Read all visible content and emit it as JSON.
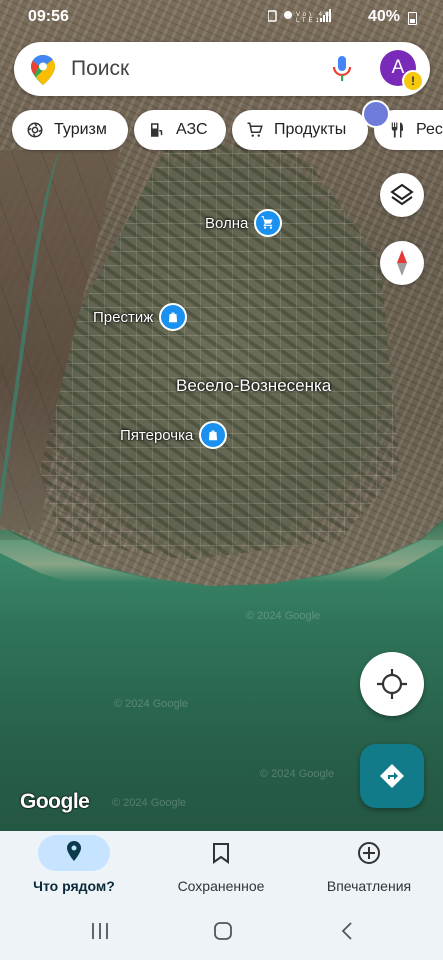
{
  "status_bar": {
    "time": "09:56",
    "network": "Vo) LTE1 4G",
    "battery": "40%"
  },
  "search": {
    "placeholder": "Поиск",
    "avatar_letter": "A",
    "avatar_color": "#7a2ab8"
  },
  "chips": [
    {
      "label": "Туризм",
      "icon": "camera-landmark-icon"
    },
    {
      "label": "АЗС",
      "icon": "gas-station-icon"
    },
    {
      "label": "Продукты",
      "icon": "shopping-cart-icon"
    },
    {
      "label": "Рест",
      "icon": "fork-knife-icon"
    }
  ],
  "map": {
    "town": "Весело-Вознесенка",
    "pois": [
      {
        "name": "Волна",
        "icon": "shopping-cart-icon"
      },
      {
        "name": "Престиж",
        "icon": "shopping-bag-icon"
      },
      {
        "name": "Пятерочка",
        "icon": "shopping-bag-icon"
      }
    ],
    "attribution": "Google",
    "watermarks": [
      "© 2024 Google",
      "© 2024 Google",
      "© 2024 Google",
      "© 2024 Google"
    ],
    "poi_color": "#1a90f0"
  },
  "bottom_nav": {
    "items": [
      {
        "label": "Что рядом?",
        "icon": "location-pin-icon",
        "active": true
      },
      {
        "label": "Сохраненное",
        "icon": "bookmark-icon",
        "active": false
      },
      {
        "label": "Впечатления",
        "icon": "add-circle-icon",
        "active": false
      }
    ]
  }
}
